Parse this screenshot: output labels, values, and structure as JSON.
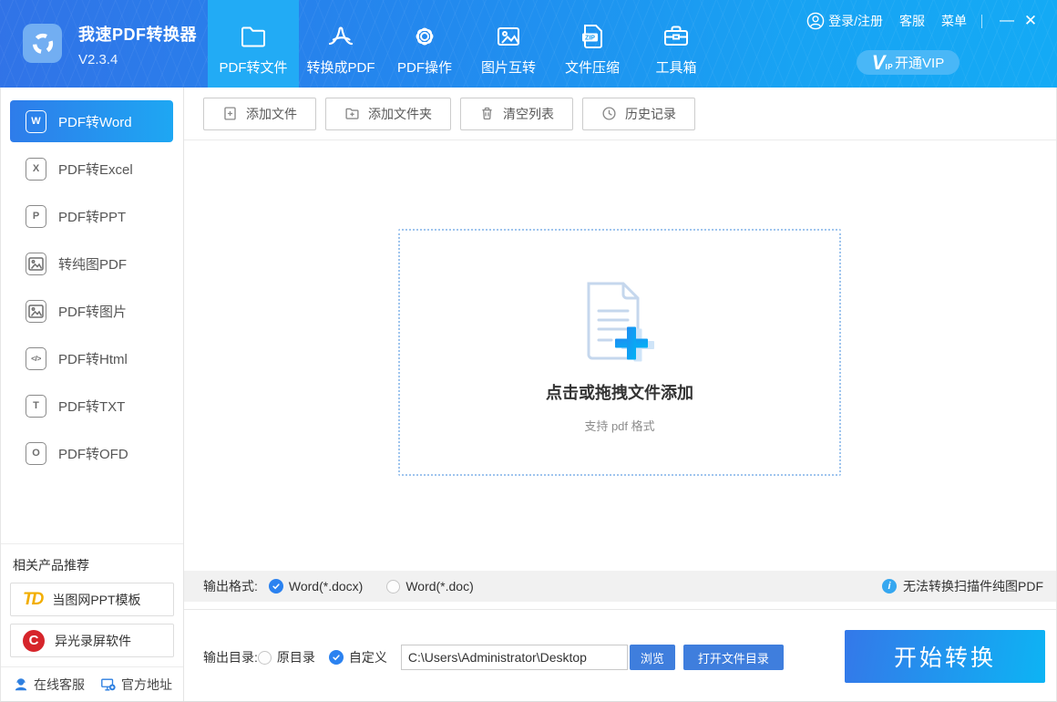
{
  "app": {
    "title": "我速PDF转换器",
    "version": "V2.3.4"
  },
  "header": {
    "tabs": [
      {
        "label": "PDF转文件",
        "icon": "folder-icon",
        "active": true
      },
      {
        "label": "转换成PDF",
        "icon": "acrobat-icon",
        "active": false
      },
      {
        "label": "PDF操作",
        "icon": "gear-icon",
        "active": false
      },
      {
        "label": "图片互转",
        "icon": "image-swap-icon",
        "active": false
      },
      {
        "label": "文件压缩",
        "icon": "zip-icon",
        "active": false
      },
      {
        "label": "工具箱",
        "icon": "toolbox-icon",
        "active": false
      }
    ],
    "account": {
      "login": "登录/注册",
      "service": "客服",
      "menu": "菜单"
    },
    "window_controls": {
      "minimize": "—",
      "close": "✕"
    },
    "vip": {
      "mark_v": "V",
      "mark_ip": "IP",
      "label": "开通VIP"
    }
  },
  "sidebar": {
    "items": [
      {
        "label": "PDF转Word",
        "badge": "W",
        "active": true
      },
      {
        "label": "PDF转Excel",
        "badge": "X",
        "active": false
      },
      {
        "label": "PDF转PPT",
        "badge": "P",
        "active": false
      },
      {
        "label": "转纯图PDF",
        "badge": "image",
        "active": false
      },
      {
        "label": "PDF转图片",
        "badge": "image",
        "active": false
      },
      {
        "label": "PDF转Html",
        "badge": "</>",
        "active": false
      },
      {
        "label": "PDF转TXT",
        "badge": "T",
        "active": false
      },
      {
        "label": "PDF转OFD",
        "badge": "O",
        "active": false
      }
    ],
    "recommend": {
      "heading": "相关产品推荐",
      "products": [
        {
          "label": "当图网PPT模板",
          "logo_text": "TD"
        },
        {
          "label": "异光录屏软件",
          "logo_text": "C"
        }
      ]
    },
    "footer": {
      "online_service": "在线客服",
      "official_site": "官方地址"
    }
  },
  "toolbar": {
    "add_file": "添加文件",
    "add_folder": "添加文件夹",
    "clear_list": "清空列表",
    "history": "历史记录"
  },
  "dropzone": {
    "title": "点击或拖拽文件添加",
    "subtitle": "支持 pdf 格式"
  },
  "format_bar": {
    "label": "输出格式:",
    "docx": "Word(*.docx)",
    "doc": "Word(*.doc)",
    "selected": "Word(*.docx)",
    "notice": "无法转换扫描件纯图PDF"
  },
  "output_bar": {
    "label": "输出目录:",
    "original": "原目录",
    "custom": "自定义",
    "selected": "自定义",
    "path": "C:\\Users\\Administrator\\Desktop",
    "browse": "浏览",
    "open_dir": "打开文件目录",
    "convert": "开始转换"
  },
  "colors": {
    "header_blue": "#3173e7",
    "header_cyan": "#14aaf5",
    "active_tab": "#22abf5",
    "sidebar_active_start": "#2e7cea",
    "sidebar_active_end": "#1ea7f3",
    "accent_radio_blue": "#2b82f0",
    "button_blue": "#3f7edd",
    "convert_start": "#3478e9",
    "convert_end": "#0db4f4",
    "vip_pill": "#49b7f7",
    "info_blue": "#35a7f0",
    "promo_gold": "#f2ae00",
    "promo_red": "#d6252b",
    "dropzone_border": "#9fc5ee"
  }
}
